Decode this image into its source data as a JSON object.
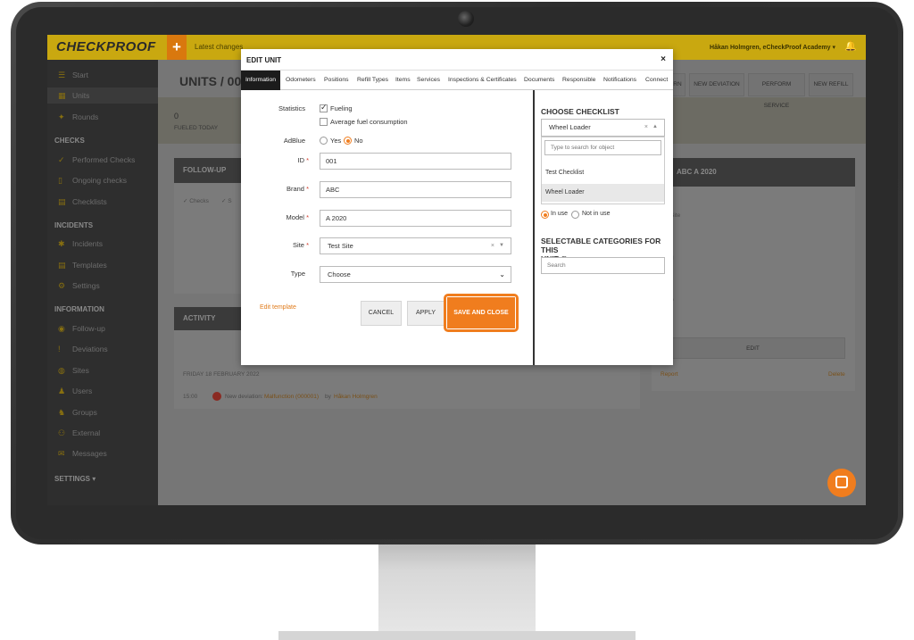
{
  "app": {
    "logo": "CHECKPROOF",
    "plus": "+",
    "latest_changes": "Latest changes",
    "user": "Håkan Holmgren, eCheckProof Academy ▾",
    "bell": "🔔"
  },
  "sidebar": {
    "items": [
      {
        "label": "Start",
        "icon": "☰"
      },
      {
        "label": "Units",
        "icon": "▦"
      },
      {
        "label": "Rounds",
        "icon": "✦"
      }
    ],
    "checks_section": "CHECKS",
    "checks": [
      {
        "label": "Performed Checks",
        "icon": "✓"
      },
      {
        "label": "Ongoing checks",
        "icon": "▯"
      },
      {
        "label": "Checklists",
        "icon": "▤"
      }
    ],
    "incidents_section": "INCIDENTS",
    "incidents": [
      {
        "label": "Incidents",
        "icon": "✱"
      },
      {
        "label": "Templates",
        "icon": "▤"
      },
      {
        "label": "Settings",
        "icon": "⚙"
      }
    ],
    "information_section": "INFORMATION",
    "information": [
      {
        "label": "Follow-up",
        "icon": "◉"
      },
      {
        "label": "Deviations",
        "icon": "!"
      },
      {
        "label": "Sites",
        "icon": "◍"
      },
      {
        "label": "Users",
        "icon": "♟"
      },
      {
        "label": "Groups",
        "icon": "♞"
      },
      {
        "label": "External",
        "icon": "⚇"
      },
      {
        "label": "Messages",
        "icon": "✉"
      }
    ],
    "settings_section": "SETTINGS ▾"
  },
  "background": {
    "page_title": "UNITS / 001,",
    "stat_value": "0",
    "stat_label": "FUELED TODAY",
    "buttons": [
      "RN",
      "NEW DEVIATION",
      "PERFORM SERVICE",
      "NEW REFILL"
    ],
    "follow_up": "FOLLOW-UP",
    "checks_filter": "✓ Checks",
    "filter_2": "✓ S",
    "activity": "ACTIVITY",
    "date": "FRIDAY 18 FEBRUARY 2022",
    "time": "15:00",
    "event_text": "New deviation:",
    "event_link": "Malfunction (000001)",
    "by": "by",
    "event_user": "Håkan Holmgren",
    "unit_title": "ABC A 2020",
    "site_fragment": "Site",
    "d_fragment": "d",
    "t_fragment": "t",
    "o_fragment": "0",
    "edit": "EDIT",
    "report": "Report",
    "delete": "Delete"
  },
  "modal": {
    "title": "EDIT UNIT",
    "close": "×",
    "tabs": [
      "Information",
      "Odometers",
      "Positions",
      "Refill Types",
      "Items",
      "Services",
      "Inspections & Certificates",
      "Documents",
      "Responsible",
      "Notifications",
      "Connect"
    ],
    "form": {
      "statistics_label": "Statistics",
      "fueling": "Fueling",
      "fueling_checked": true,
      "avg_fuel": "Average fuel consumption",
      "avg_fuel_checked": false,
      "adblue_label": "AdBlue",
      "adblue_yes": "Yes",
      "adblue_no": "No",
      "adblue_selected": "No",
      "id_label": "ID",
      "id_value": "001",
      "brand_label": "Brand",
      "brand_value": "ABC",
      "model_label": "Model",
      "model_value": "A 2020",
      "site_label": "Site",
      "site_value": "Test Site",
      "type_label": "Type",
      "type_value": "Choose",
      "required_mark": "*",
      "clear_glyph": "×",
      "arrows_glyph": "▼",
      "caret_glyph": "⌄"
    },
    "edit_template": "Edit template",
    "cancel": "CANCEL",
    "apply": "APPLY",
    "save_close": "SAVE AND CLOSE",
    "checklist": {
      "title": "CHOOSE CHECKLIST",
      "selected": "Wheel Loader",
      "search_placeholder": "Type to search for object",
      "options": [
        "Test Checklist",
        "Wheel Loader"
      ],
      "clear_glyph": "×",
      "up_glyph": "▲",
      "in_use": "In use",
      "not_in_use": "Not in use",
      "use_selected": "In use"
    },
    "categories": {
      "title_line1": "SELECTABLE CATEGORIES FOR THIS",
      "title_line2": "UNIT",
      "help": "?",
      "search_placeholder": "Search"
    }
  }
}
